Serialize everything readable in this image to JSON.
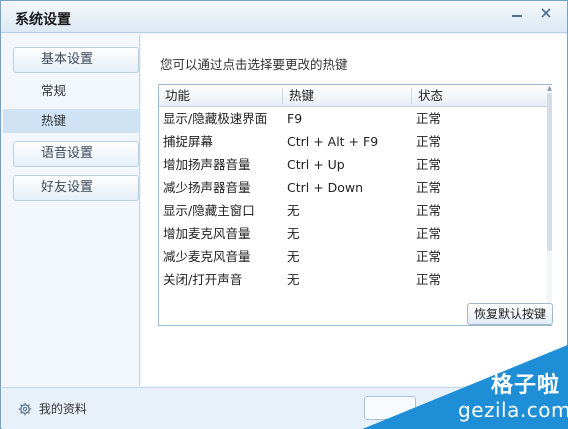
{
  "window": {
    "title": "系统设置"
  },
  "sidebar": {
    "categories": {
      "basic": "基本设置",
      "voice": "语音设置",
      "friends": "好友设置"
    },
    "subitems": {
      "general": "常规",
      "hotkeys": "热键"
    }
  },
  "main": {
    "instruction": "您可以通过点击选择要更改的热键",
    "columns": [
      "功能",
      "热键",
      "状态"
    ],
    "rows": [
      {
        "function": "显示/隐藏极速界面",
        "hotkey": "F9",
        "status": "正常"
      },
      {
        "function": "捕捉屏幕",
        "hotkey": "Ctrl + Alt + F9",
        "status": "正常"
      },
      {
        "function": "增加扬声器音量",
        "hotkey": "Ctrl + Up",
        "status": "正常"
      },
      {
        "function": "减少扬声器音量",
        "hotkey": "Ctrl + Down",
        "status": "正常"
      },
      {
        "function": "显示/隐藏主窗口",
        "hotkey": "无",
        "status": "正常"
      },
      {
        "function": "增加麦克风音量",
        "hotkey": "无",
        "status": "正常"
      },
      {
        "function": "减少麦克风音量",
        "hotkey": "无",
        "status": "正常"
      },
      {
        "function": "关闭/打开声音",
        "hotkey": "无",
        "status": "正常"
      }
    ],
    "restore_button": "恢复默认按键"
  },
  "footer": {
    "profile_label": "我的资料"
  },
  "watermark": {
    "brand": "格子啦",
    "url": "gezila.com"
  },
  "colors": {
    "accent": "#cfe3f4",
    "watermark": "#1e8fd6",
    "border": "#7aa0bf"
  },
  "icons": {
    "minimize": "minimize-icon",
    "close": "close-icon",
    "profile": "gear-icon"
  }
}
